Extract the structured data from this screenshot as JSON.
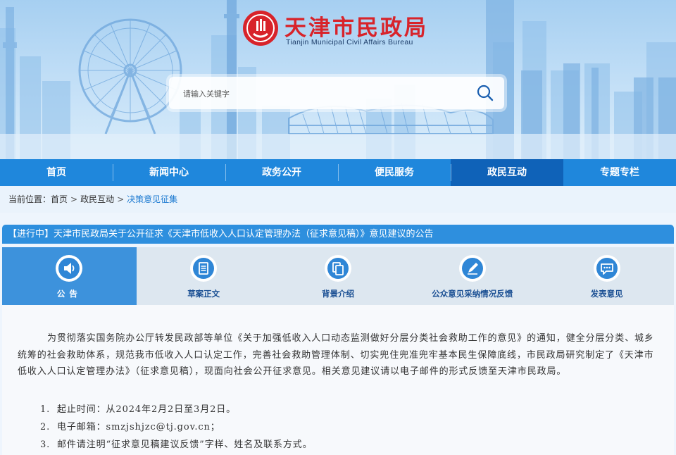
{
  "site": {
    "name_cn": "天津市民政局",
    "name_en": "Tianjin Municipal Civil Affairs Bureau"
  },
  "search": {
    "placeholder": "请输入关键字"
  },
  "nav": {
    "items": [
      {
        "label": "首页"
      },
      {
        "label": "新闻中心"
      },
      {
        "label": "政务公开"
      },
      {
        "label": "便民服务"
      },
      {
        "label": "政民互动"
      },
      {
        "label": "专题专栏"
      }
    ],
    "active_index": 4
  },
  "breadcrumb": {
    "prefix": "当前位置：",
    "items": [
      "首页",
      "政民互动",
      "决策意见征集"
    ],
    "separator": ">"
  },
  "notice": {
    "title": "【进行中】天津市民政局关于公开征求《天津市低收入人口认定管理办法（征求意见稿）》意见建议的公告"
  },
  "tabs": {
    "items": [
      {
        "label": "公告",
        "icon": "speaker-icon"
      },
      {
        "label": "草案正文",
        "icon": "document-icon"
      },
      {
        "label": "背景介绍",
        "icon": "copy-icon"
      },
      {
        "label": "公众意见采纳情况反馈",
        "icon": "pen-icon"
      },
      {
        "label": "发表意见",
        "icon": "chat-icon"
      }
    ],
    "active_index": 0
  },
  "body": {
    "paragraph": "为贯彻落实国务院办公厅转发民政部等单位《关于加强低收入人口动态监测做好分层分类社会救助工作的意见》的通知，健全分层分类、城乡统筹的社会救助体系，规范我市低收入人口认定工作，完善社会救助管理体制、切实兜住兜准兜牢基本民生保障底线，市民政局研究制定了《天津市低收入人口认定管理办法》（征求意见稿），现面向社会公开征求意见。相关意见建议请以电子邮件的形式反馈至天津市民政局。",
    "list": [
      {
        "num": "1.",
        "text": "起止时间：从2024年2月2日至3月2日。"
      },
      {
        "num": "2.",
        "text": "电子邮箱：smzjshjzc@tj.gov.cn；"
      },
      {
        "num": "3.",
        "text": "邮件请注明“征求意见稿建议反馈”字样、姓名及联系方式。"
      }
    ]
  },
  "colors": {
    "brand_red": "#d8232a",
    "nav_blue": "#1f87dc",
    "nav_active": "#0f62b8",
    "tab_active": "#3d92dc",
    "breadcrumb_current": "#1a78d0"
  }
}
